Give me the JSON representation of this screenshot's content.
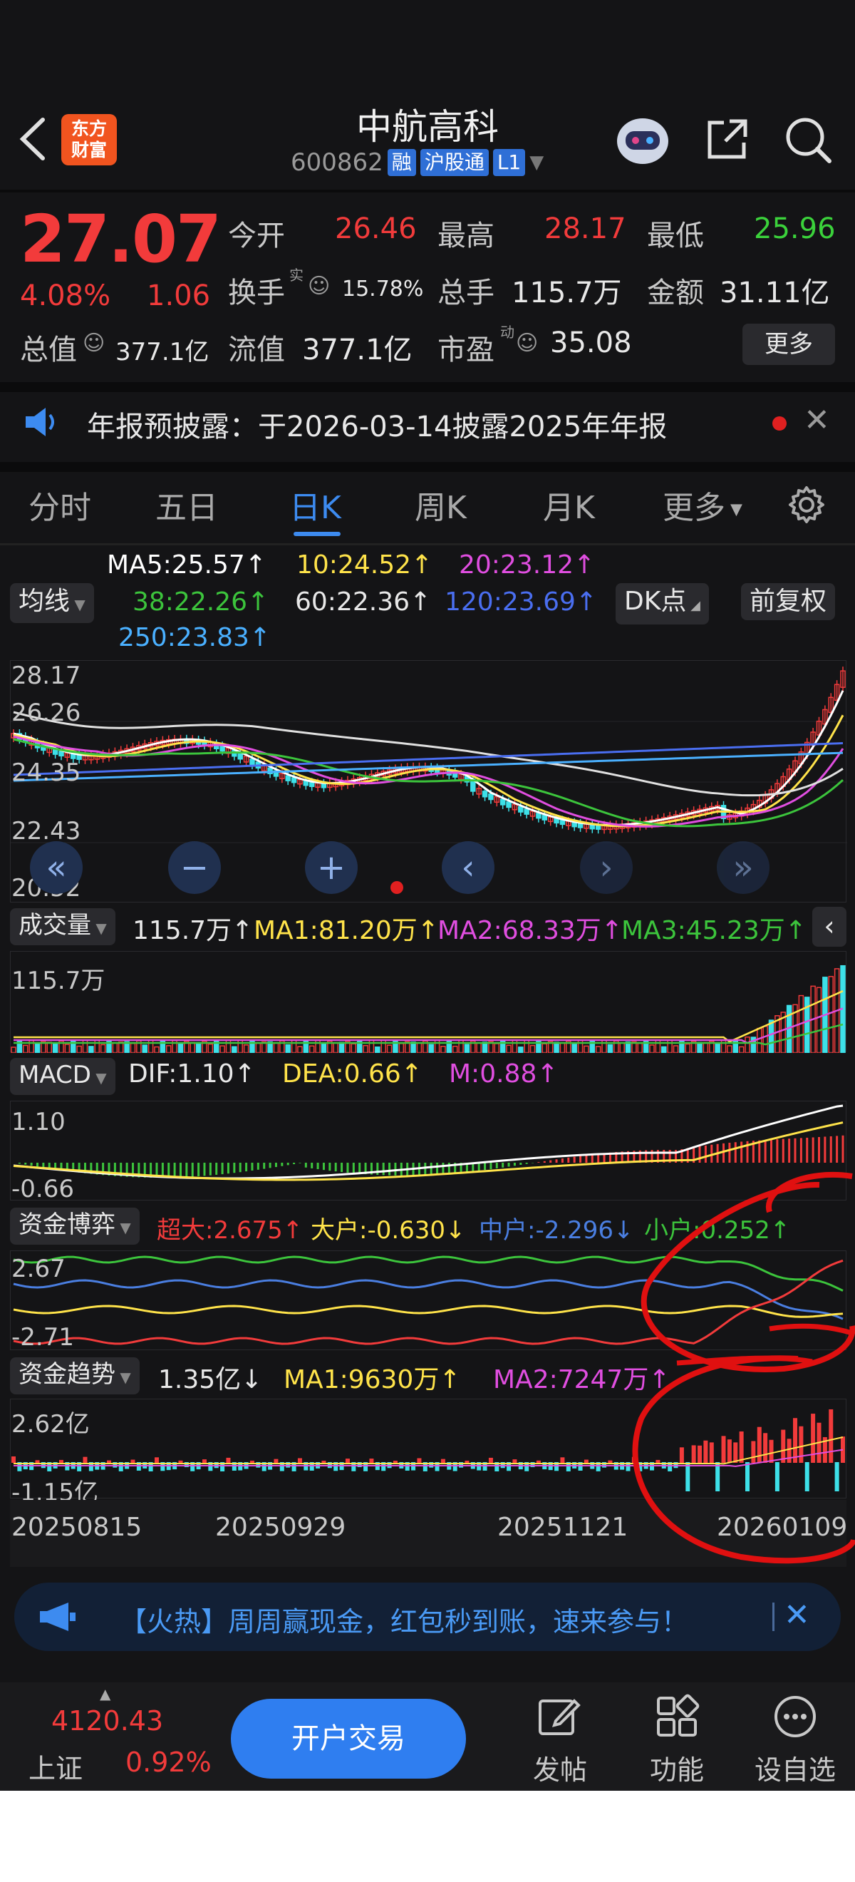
{
  "header": {
    "title": "中航高科",
    "code": "600862",
    "tags": [
      "融",
      "沪股通",
      "L1"
    ],
    "logo_text": [
      "东方",
      "财富"
    ]
  },
  "quote": {
    "price": "27.07",
    "change_pct": "4.08%",
    "change": "1.06",
    "open_label": "今开",
    "open": "26.46",
    "high_label": "最高",
    "high": "28.17",
    "low_label": "最低",
    "low": "25.96",
    "turnover_label": "换手",
    "turnover_sup": "实",
    "turnover": "15.78%",
    "volume_label": "总手",
    "volume": "115.7万",
    "amount_label": "金额",
    "amount": "31.11亿",
    "mktcap_label": "总值",
    "mktcap": "377.1亿",
    "float_label": "流值",
    "float": "377.1亿",
    "pe_label": "市盈",
    "pe_sup": "动",
    "pe": "35.08",
    "more_button": "更多"
  },
  "notice": {
    "text": "年报预披露：于2026-03-14披露2025年年报"
  },
  "tabs": {
    "items": [
      "分时",
      "五日",
      "日K",
      "周K",
      "月K",
      "更多"
    ],
    "active": "日K"
  },
  "ma": {
    "selector": "均线",
    "ma5": "MA5:25.57↑",
    "ma10": "10:24.52↑",
    "ma20": "20:23.12↑",
    "ma38": "38:22.26↑",
    "ma60": "60:22.36↑",
    "ma120": "120:23.69↑",
    "ma250": "250:23.83↑",
    "dk_button": "DK点",
    "adjust_button": "前复权"
  },
  "kline": {
    "y_labels": [
      "28.17",
      "26.26",
      "24.35",
      "22.43",
      "20.52"
    ]
  },
  "volume": {
    "selector": "成交量",
    "value": "115.7万↑",
    "ma1": "MA1:81.20万↑",
    "ma2": "MA2:68.33万↑",
    "ma3": "MA3:45.23万↑",
    "y_label": "115.7万"
  },
  "macd": {
    "selector": "MACD",
    "dif": "DIF:1.10↑",
    "dea": "DEA:0.66↑",
    "m": "M:0.88↑",
    "y_top": "1.10",
    "y_bottom": "-0.66"
  },
  "fund_game": {
    "selector": "资金博弈",
    "super": "超大:2.675↑",
    "big": "大户:-0.630↓",
    "mid": "中户:-2.296↓",
    "small": "小户:0.252↑",
    "y_top": "2.67",
    "y_bottom": "-2.71"
  },
  "fund_trend": {
    "selector": "资金趋势",
    "value": "1.35亿↓",
    "ma1": "MA1:9630万↑",
    "ma2": "MA2:7247万↑",
    "y_top": "2.62亿",
    "y_bottom": "-1.15亿"
  },
  "x_dates": [
    "20250815",
    "20250929",
    "20251121",
    "20260109"
  ],
  "banner": {
    "text": "【火热】周周赢现金，红包秒到账，速来参与！"
  },
  "bottom": {
    "index_value": "4120.43",
    "index_name": "上证",
    "index_change": "0.92%",
    "trade_button": "开户交易",
    "items": [
      "发帖",
      "功能",
      "设自选"
    ]
  },
  "colors": {
    "up": "#f23b3b",
    "down": "#3de0e8",
    "accent": "#3d8bf0",
    "ma5": "#ffffff",
    "ma10": "#ffe34a",
    "ma20": "#e04ee0",
    "ma38": "#3cc43c",
    "ma120": "#4a6ef0",
    "ma250": "#4ab0ff"
  }
}
